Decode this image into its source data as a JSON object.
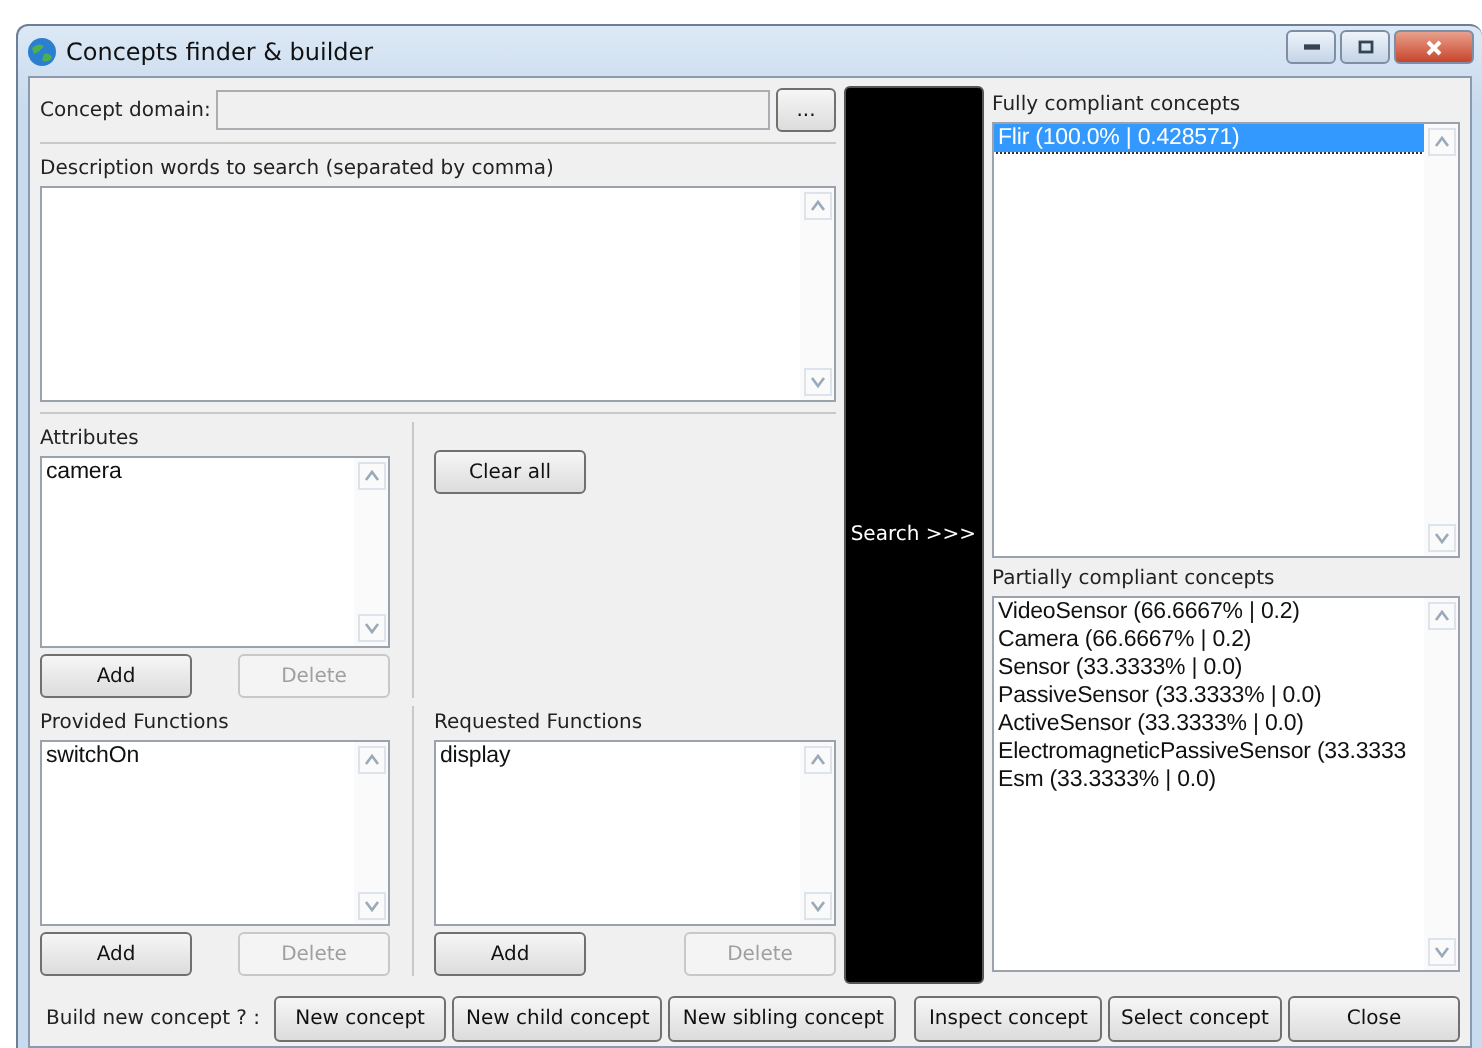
{
  "window": {
    "title": "Concepts finder & builder"
  },
  "domain": {
    "label": "Concept domain:",
    "browse_button": "..."
  },
  "description": {
    "label": "Description words to search (separated by comma)"
  },
  "attributes": {
    "label": "Attributes",
    "items": [
      {
        "text": "camera",
        "selected": false
      }
    ],
    "buttons": [
      {
        "label": "Add",
        "disabled": false
      },
      {
        "label": "Delete",
        "disabled": true
      }
    ]
  },
  "clear_button": "Clear all",
  "provided_functions": {
    "label": "Provided Functions",
    "items": [
      {
        "text": "switchOn",
        "selected": false
      }
    ],
    "buttons": [
      {
        "label": "Add",
        "disabled": false
      },
      {
        "label": "Delete",
        "disabled": true
      }
    ]
  },
  "requested_functions": {
    "label": "Requested Functions",
    "items": [
      {
        "text": "display",
        "selected": false
      }
    ],
    "buttons": [
      {
        "label": "Add",
        "disabled": false
      },
      {
        "label": "Delete",
        "disabled": true
      }
    ]
  },
  "search_button": "Search >>>",
  "fully_compliant": {
    "label": "Fully compliant concepts",
    "items": [
      {
        "text": "Flir (100.0% | 0.428571)",
        "selected": true
      }
    ]
  },
  "partially_compliant": {
    "label": "Partially compliant concepts",
    "items": [
      {
        "text": "VideoSensor (66.6667% | 0.2)",
        "selected": false
      },
      {
        "text": "Camera (66.6667% | 0.2)",
        "selected": false
      },
      {
        "text": "Sensor (33.3333% | 0.0)",
        "selected": false
      },
      {
        "text": "PassiveSensor (33.3333% | 0.0)",
        "selected": false
      },
      {
        "text": "ActiveSensor (33.3333% | 0.0)",
        "selected": false
      },
      {
        "text": "ElectromagneticPassiveSensor (33.3333",
        "selected": false
      },
      {
        "text": "Esm (33.3333% | 0.0)",
        "selected": false
      }
    ]
  },
  "bottom_bar": {
    "label": "Build new concept ? :",
    "buttons": [
      {
        "label": "New concept",
        "disabled": false
      },
      {
        "label": "New child concept",
        "disabled": false
      },
      {
        "label": "New sibling concept",
        "disabled": false
      },
      {
        "label": "Inspect concept",
        "disabled": false
      },
      {
        "label": "Select concept",
        "disabled": false
      },
      {
        "label": "Close",
        "disabled": false
      }
    ]
  }
}
